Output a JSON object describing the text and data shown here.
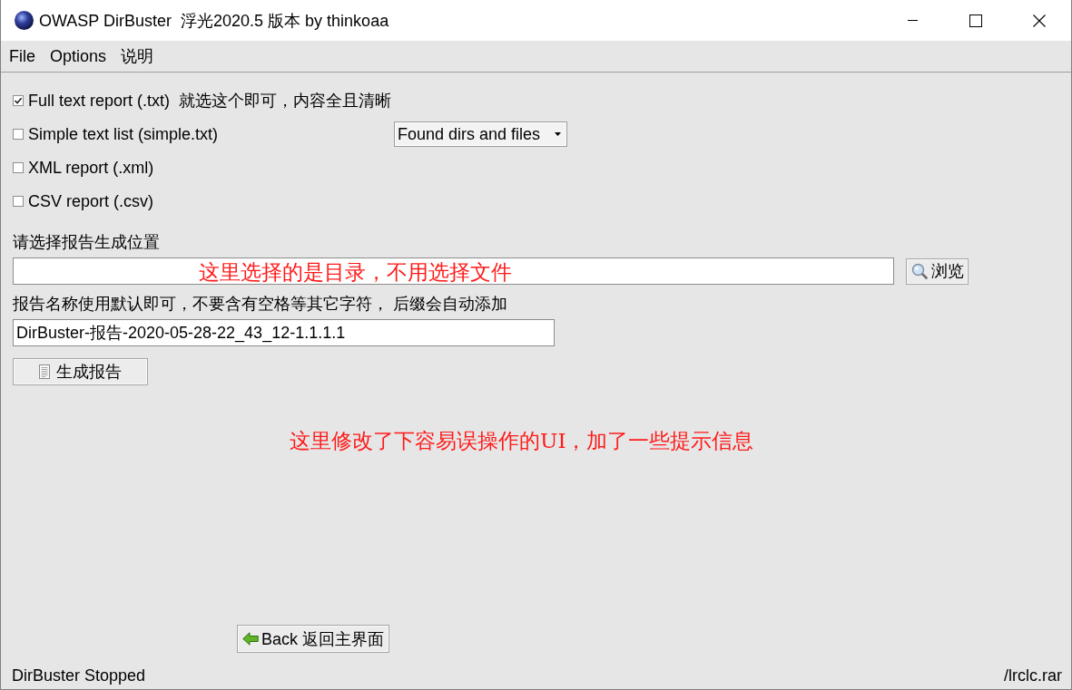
{
  "window": {
    "title": "OWASP DirBuster  浮光2020.5 版本 by thinkoaa"
  },
  "menu": [
    {
      "label": "File"
    },
    {
      "label": "Options"
    },
    {
      "label": "说明"
    }
  ],
  "report_options": [
    {
      "label": "Full text report (.txt)",
      "checked": true,
      "hint": "就选这个即可，内容全且清晰"
    },
    {
      "label": "Simple text list (simple.txt)",
      "checked": false,
      "dropdown": {
        "value": "Found dirs and files"
      }
    },
    {
      "label": "XML report (.xml)",
      "checked": false
    },
    {
      "label": "CSV report (.csv)",
      "checked": false
    }
  ],
  "location": {
    "label": "请选择报告生成位置",
    "annotation": "这里选择的是目录，不用选择文件",
    "browse_button": "浏览"
  },
  "report_name": {
    "label": "报告名称使用默认即可，不要含有空格等其它字符， 后缀会自动添加",
    "value": "DirBuster-报告-2020-05-28-22_43_12-1.1.1.1"
  },
  "generate_button": "生成报告",
  "annotation": "这里修改了下容易误操作的UI，加了一些提示信息",
  "back_button": "Back 返回主界面",
  "status_bar": {
    "left": "DirBuster Stopped",
    "right": "/lrclc.rar"
  }
}
